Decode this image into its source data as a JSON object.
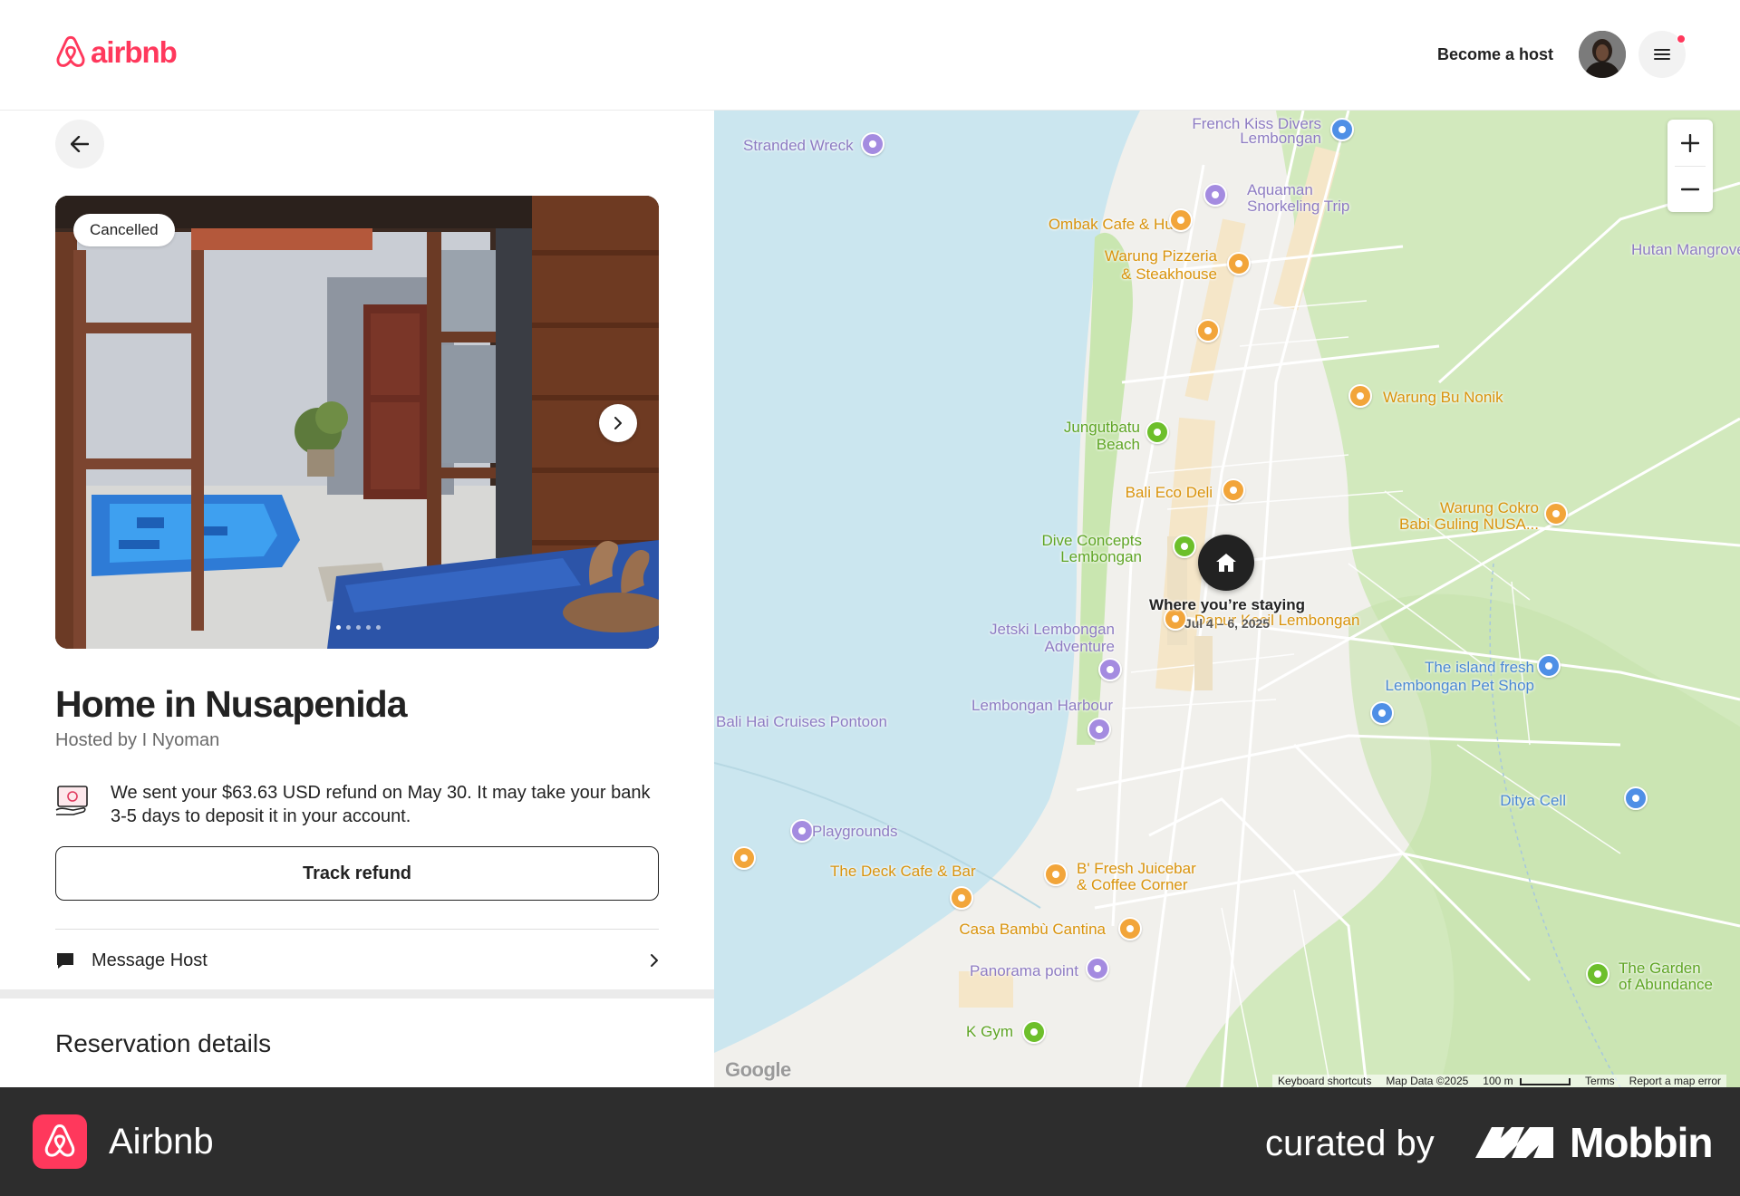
{
  "header": {
    "logo_text": "airbnb",
    "become_host": "Become a host",
    "brand_color": "#ff385c"
  },
  "reservation": {
    "badge": "Cancelled",
    "title": "Home in Nusapenida",
    "host": "Hosted by I Nyoman",
    "refund_message": "We sent your $63.63 USD refund on May 30. It may take your bank 3-5 days to deposit it in your account.",
    "track_refund": "Track refund",
    "message_host": "Message Host",
    "section_title": "Reservation details",
    "photo_count": 5,
    "photo_index": 1
  },
  "map": {
    "stay_label": "Where you’re staying",
    "stay_dates": "Jul 4 – 6, 2025",
    "pois": {
      "stranded_wreck": "Stranded Wreck",
      "french_kiss_1": "French Kiss Divers",
      "french_kiss_2": "Lembongan",
      "aquaman_1": "Aquaman",
      "aquaman_2": "Snorkeling Trip",
      "ombak": "Ombak Cafe & Huts",
      "pizzeria_1": "Warung Pizzeria",
      "pizzeria_2": "& Steakhouse",
      "hutan": "Hutan Mangrove",
      "bu_nonik": "Warung Bu Nonik",
      "jungutbatu_1": "Jungutbatu",
      "jungutbatu_2": "Beach",
      "eco_deli": "Bali Eco Deli",
      "cokro_1": "Warung Cokro",
      "cokro_2": "Babi Guling NUSA...",
      "dive_1": "Dive Concepts",
      "dive_2": "Lembongan",
      "dapur": "Dapur Kecil Lembongan",
      "jetski_1": "Jetski Lembongan",
      "jetski_2": "Adventure",
      "island_1": "The island fresh",
      "island_2": "Lembongan Pet Shop",
      "harbour": "Lembongan Harbour",
      "bali_hai": "Bali Hai Cruises Pontoon",
      "ditya": "Ditya Cell",
      "playgrounds": "Playgrounds",
      "deck": "The Deck Cafe & Bar",
      "juicebar_1": "B' Fresh Juicebar",
      "juicebar_2": "& Coffee Corner",
      "casa": "Casa Bambù Cantina",
      "panorama": "Panorama point",
      "garden_1": "The Garden",
      "garden_2": "of Abundance",
      "kgym": "K Gym"
    },
    "google": "Google",
    "keyboard": "Keyboard shortcuts",
    "map_data": "Map Data ©2025",
    "scale": "100 m",
    "terms": "Terms",
    "report": "Report a map error",
    "colors": {
      "water": "#cbe6ef",
      "land": "#f1f0ec",
      "green": "#c9e6b0",
      "sand": "#f5e6c8"
    }
  },
  "footer": {
    "app_name": "Airbnb",
    "curated_by": "curated by",
    "mobbin": "Mobbin"
  }
}
